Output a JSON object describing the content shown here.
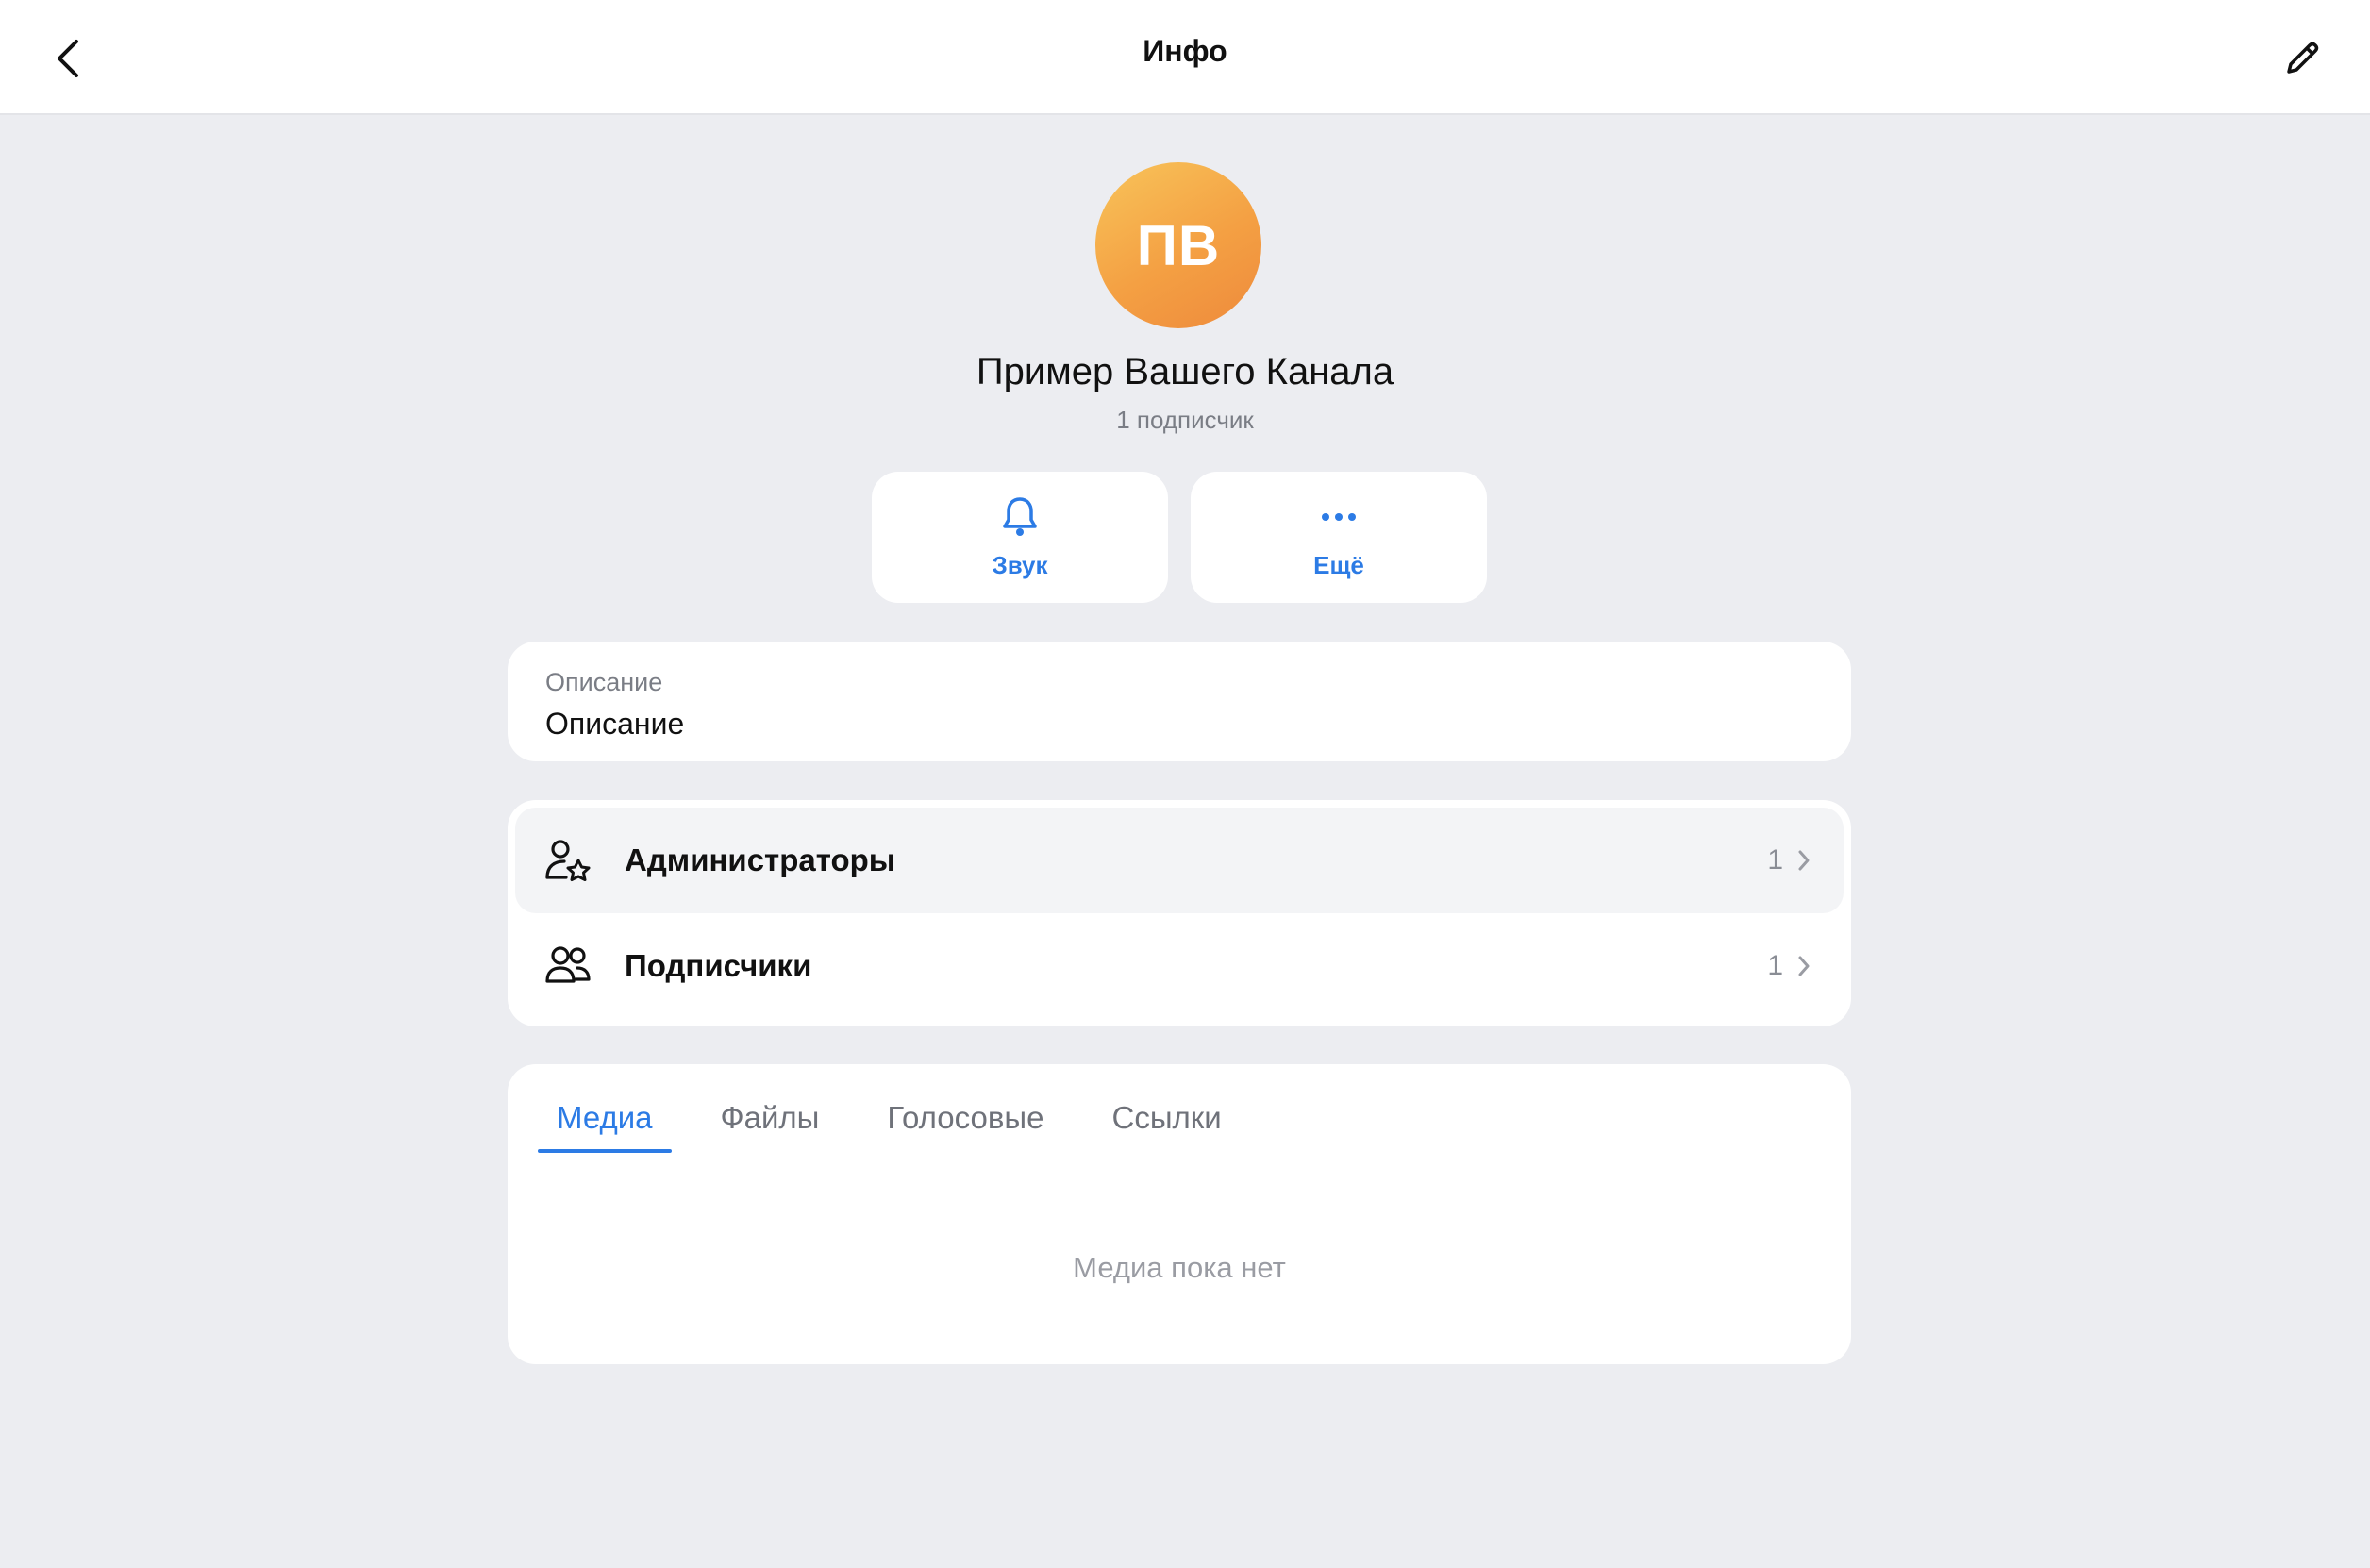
{
  "header": {
    "title": "Инфо",
    "back_icon": "chevron-left-icon",
    "edit_icon": "pencil-icon"
  },
  "channel": {
    "initials": "ПВ",
    "name": "Пример Вашего Канала",
    "subscribers": "1 подписчик"
  },
  "actions": {
    "sound_label": "Звук",
    "sound_icon": "bell-icon",
    "more_label": "Ещё",
    "more_icon": "ellipsis-icon"
  },
  "description": {
    "label": "Описание",
    "value": "Описание"
  },
  "members": [
    {
      "label": "Администраторы",
      "count": "1",
      "icon": "admin-star-icon"
    },
    {
      "label": "Подписчики",
      "count": "1",
      "icon": "users-icon"
    }
  ],
  "media": {
    "tabs": [
      {
        "label": "Медиа",
        "active": true
      },
      {
        "label": "Файлы",
        "active": false
      },
      {
        "label": "Голосовые",
        "active": false
      },
      {
        "label": "Ссылки",
        "active": false
      }
    ],
    "empty_text": "Медиа пока нет"
  },
  "colors": {
    "accent": "#2c7be5",
    "background": "#ecedf1",
    "avatar_gradient_start": "#f8c45a",
    "avatar_gradient_end": "#ee8a3c"
  }
}
